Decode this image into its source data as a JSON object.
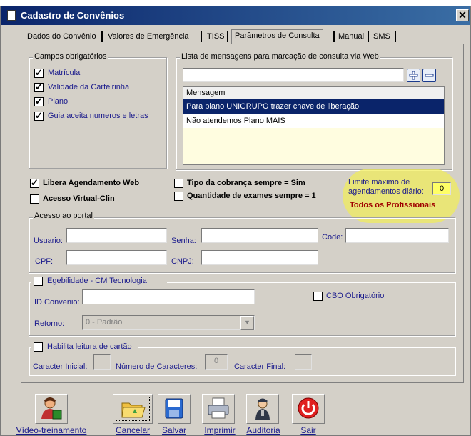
{
  "window": {
    "title": "Cadastro de Convênios",
    "close_glyph": "✕"
  },
  "tabs": [
    {
      "label": "Dados do Convênio"
    },
    {
      "label": "Valores de Emergência"
    },
    {
      "label": "TISS"
    },
    {
      "label": "Parâmetros de Consulta"
    },
    {
      "label": "Manual"
    },
    {
      "label": "SMS"
    }
  ],
  "required_fields": {
    "legend": "Campos obrigatórios",
    "items": [
      {
        "label": "Matrícula",
        "checked": true
      },
      {
        "label": "Validade da Carteirinha",
        "checked": true
      },
      {
        "label": "Plano",
        "checked": true
      },
      {
        "label": "Guia aceita numeros e letras",
        "checked": true
      }
    ]
  },
  "messages": {
    "legend": "Lista de mensagens para marcação de consulta via Web",
    "input_value": "",
    "column": "Mensagem",
    "rows": [
      {
        "text": "Para plano UNIGRUPO trazer chave de liberação",
        "selected": true
      },
      {
        "text": "Não atendemos Plano MAIS",
        "selected": false
      }
    ]
  },
  "options": {
    "libera_web": {
      "label": "Libera Agendamento Web",
      "checked": true
    },
    "acesso_virtual": {
      "label": "Acesso Virtual-Clin",
      "checked": false
    },
    "tipo_cobranca": {
      "label": "Tipo da cobrança sempre = Sim",
      "checked": false
    },
    "qtd_exames": {
      "label": "Quantidade de exames sempre = 1",
      "checked": false
    },
    "limite_label": "Limite máximo de agendamentos diário:",
    "limite_value": "0",
    "todos_profissionais": "Todos os Profissionais"
  },
  "portal": {
    "legend": "Acesso ao portal",
    "usuario_label": "Usuario:",
    "usuario_value": "",
    "senha_label": "Senha:",
    "senha_value": "",
    "code_label": "Code:",
    "code_value": "",
    "cpf_label": "CPF:",
    "cpf_value": "",
    "cnpj_label": "CNPJ:",
    "cnpj_value": ""
  },
  "elegibilidade": {
    "legend": "Egebilidade - CM Tecnologia",
    "checked": false,
    "id_label": "ID Convenio:",
    "id_value": "",
    "cbo_label": "CBO Obrigatório",
    "cbo_checked": false,
    "retorno_label": "Retorno:",
    "retorno_value": "0 - Padrão"
  },
  "cartao": {
    "legend": "Habilita leitura de cartão",
    "checked": false,
    "inicial_label": "Caracter Inicial:",
    "inicial_value": "",
    "numero_label": "Número de Caracteres:",
    "numero_value": "0",
    "final_label": "Caracter Final:",
    "final_value": ""
  },
  "toolbar": {
    "video_label": "Vídeo-treinamento",
    "cancelar_label": "Cancelar",
    "salvar_label": "Salvar",
    "imprimir_label": "Imprimir",
    "auditoria_label": "Auditoria",
    "sair_label": "Sair"
  },
  "colors": {
    "title_bar": "#0a246a",
    "selection": "#0a246a",
    "highlight": "#ffff00",
    "label_blue": "#1a1a8c",
    "exit_red": "#e02020"
  }
}
